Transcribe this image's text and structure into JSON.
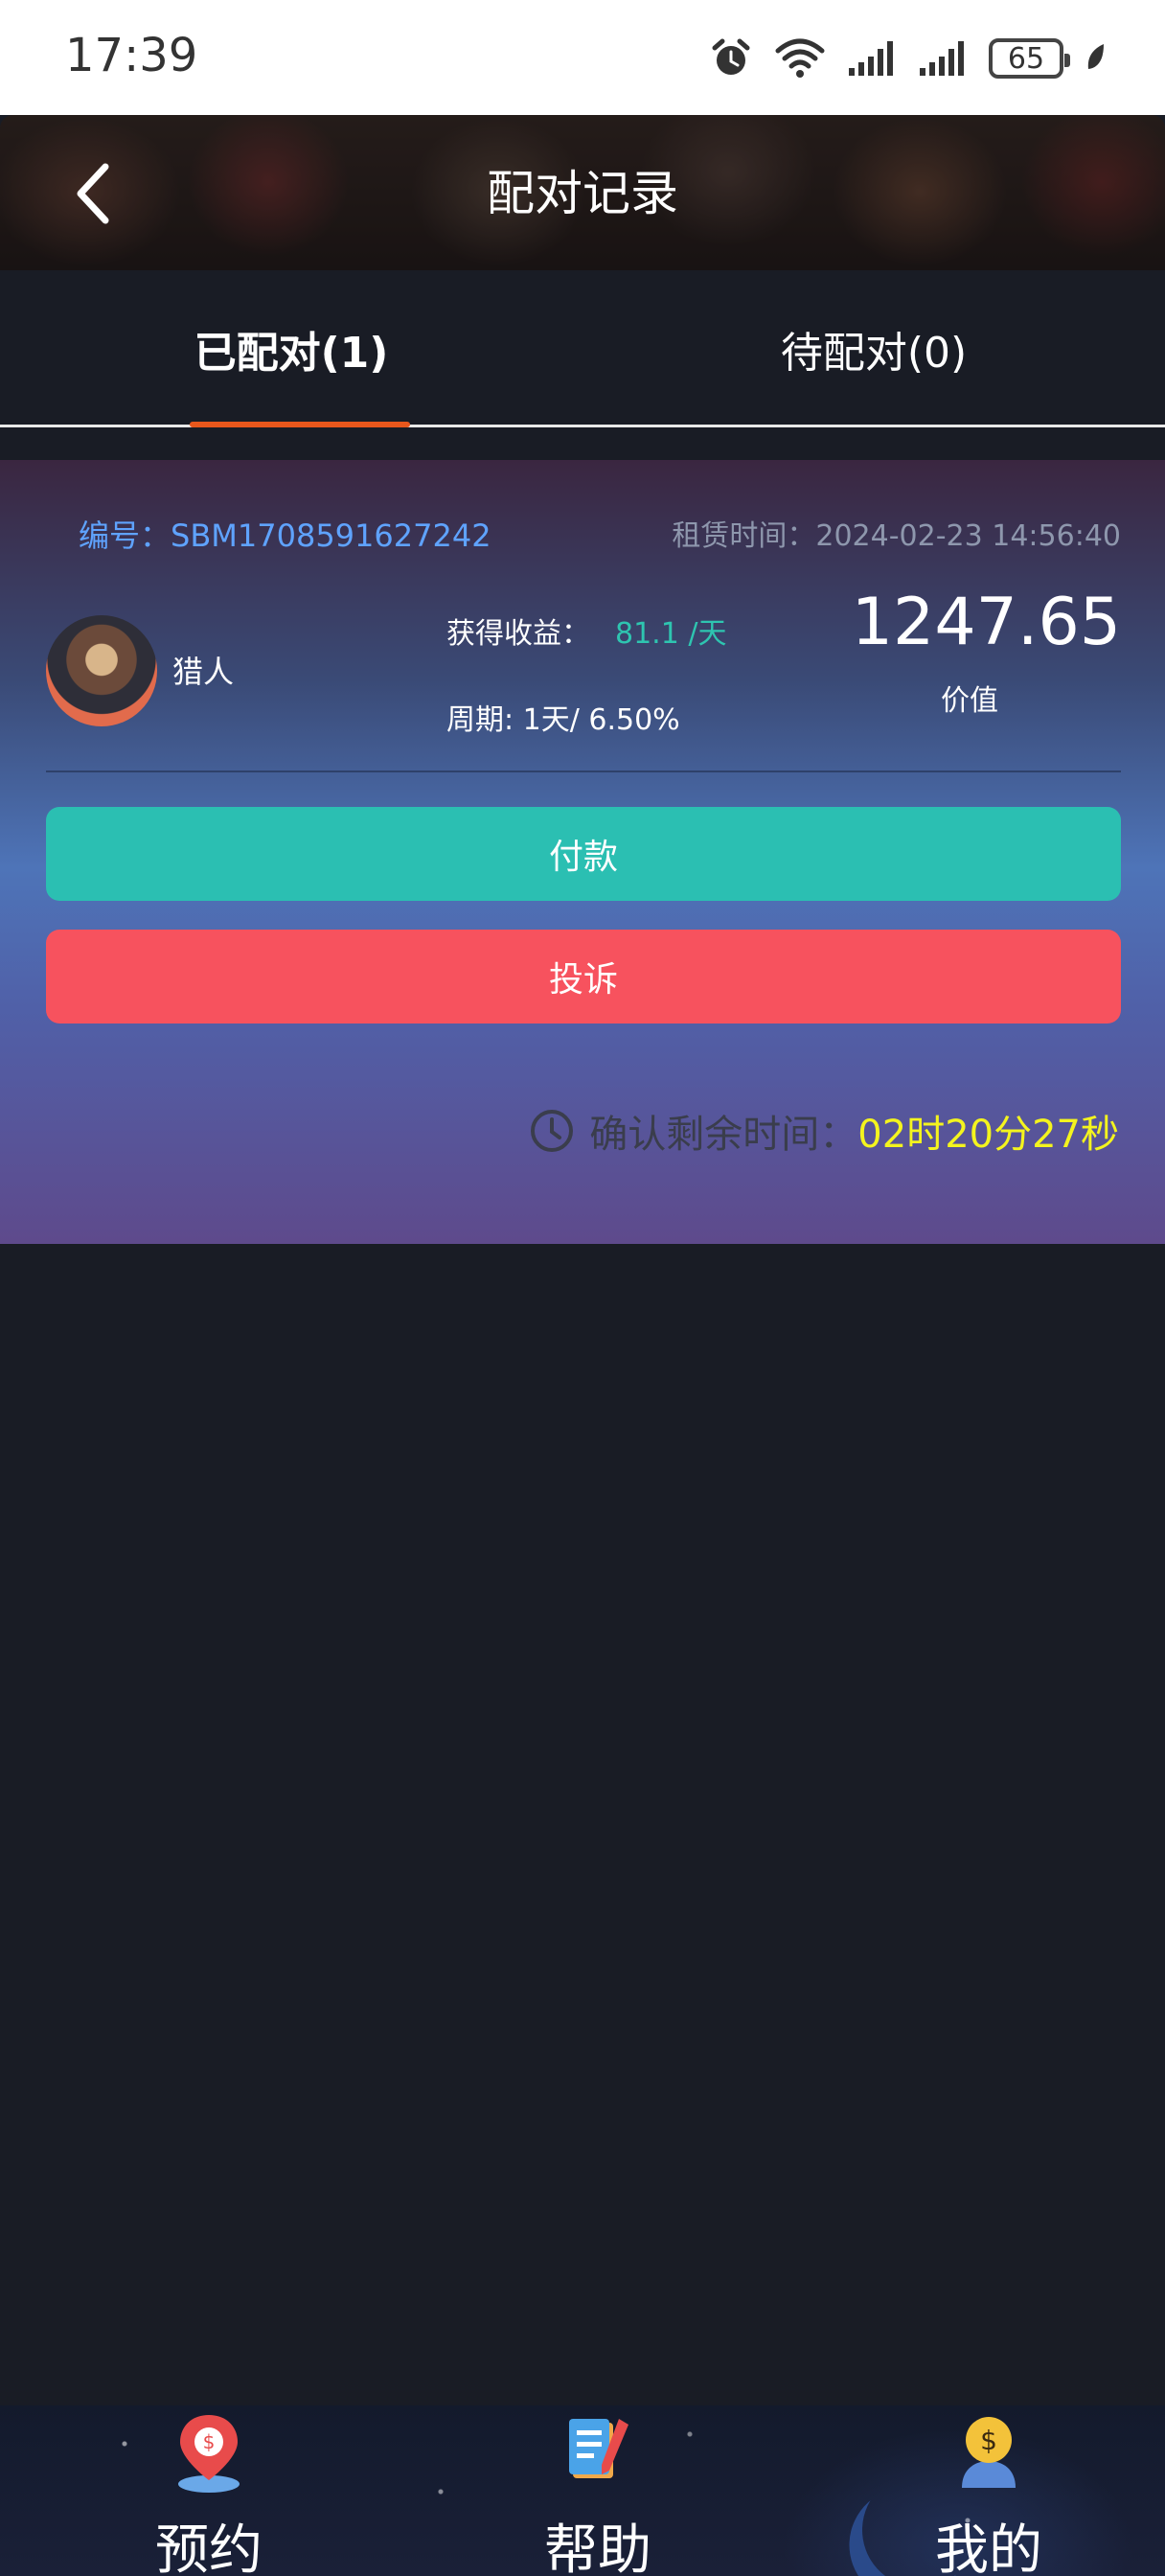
{
  "status_bar": {
    "time": "17:39",
    "battery": "65",
    "icons": [
      "alarm-icon",
      "wifi-icon",
      "signal-icon",
      "signal-icon",
      "battery-icon",
      "leaf-icon"
    ]
  },
  "header": {
    "title": "配对记录",
    "back_icon": "chevron-left-icon"
  },
  "tabs": [
    {
      "label": "已配对(1)",
      "active": true
    },
    {
      "label": "待配对(0)",
      "active": false
    }
  ],
  "colors": {
    "accent": "#e8571c",
    "pay_button": "#2bbfb2",
    "complain_button": "#f7525e",
    "order_no": "#5fa3ff",
    "income": "#2ec5b0",
    "countdown": "#f4f41e"
  },
  "record": {
    "order_no": "编号：SBM1708591627242",
    "rent_time": "租赁时间：2024-02-23 14:56:40",
    "character_name": "猎人",
    "income_label": "获得收益：",
    "income_value": "81.1 /天",
    "cycle": "周期: 1天/ 6.50%",
    "value": "1247.65",
    "value_label": "价值",
    "pay_button": "付款",
    "complain_button": "投诉",
    "countdown_label": "确认剩余时间：",
    "countdown_value": "02时20分27秒"
  },
  "bottom_nav": [
    {
      "label": "预约",
      "icon": "location-money-icon"
    },
    {
      "label": "帮助",
      "icon": "document-pen-icon"
    },
    {
      "label": "我的",
      "icon": "user-money-icon"
    }
  ]
}
